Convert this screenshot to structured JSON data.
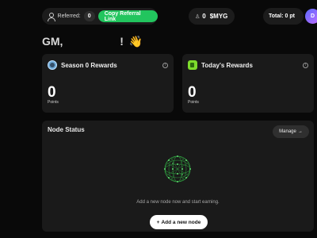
{
  "topbar": {
    "referred_label": "Referred:",
    "referred_count": "0",
    "copy_referral": "Copy Referral Link",
    "balance_amount": "0",
    "balance_symbol": "$MYG",
    "total": "Total: 0 pt",
    "avatar_initial": "D"
  },
  "greeting": {
    "prefix": "GM,",
    "suffix": "!",
    "emoji": "👋"
  },
  "cards": {
    "season": {
      "title": "Season 0 Rewards",
      "value": "0",
      "unit": "Points"
    },
    "today": {
      "title": "Today's Rewards",
      "value": "0",
      "unit": "Points"
    }
  },
  "node_status": {
    "title": "Node Status",
    "manage": "Manage",
    "manage_arrow": "→",
    "empty_message": "Add a new node now and start earning.",
    "add_button_plus": "+",
    "add_button": "Add a new node"
  },
  "icons": {
    "referred": "person-icon",
    "balance": "myg-coin-icon",
    "season": "globe-icon",
    "today": "jar-icon",
    "info": "info-icon",
    "node": "network-sphere-icon"
  },
  "colors": {
    "accent_green": "#22c55e",
    "background": "#090909",
    "card": "#1a1a1a"
  }
}
